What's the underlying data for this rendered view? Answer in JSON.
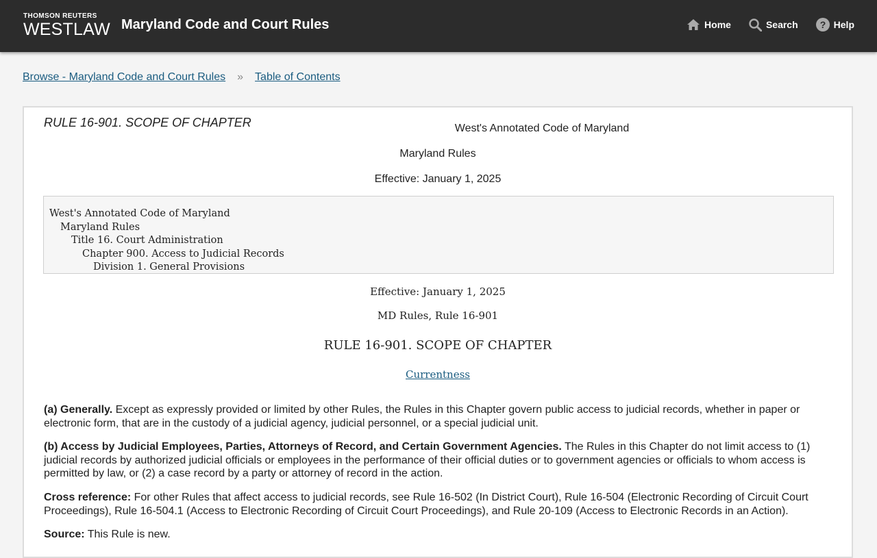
{
  "header": {
    "brand_small": "THOMSON REUTERS",
    "brand_big": "WESTLAW",
    "app_title": "Maryland Code and Court Rules",
    "nav": {
      "home": "Home",
      "search": "Search",
      "help": "Help"
    }
  },
  "breadcrumb": {
    "browse": "Browse - Maryland Code and Court Rules",
    "separator": "»",
    "toc": "Table of Contents"
  },
  "document": {
    "rule_heading": "RULE 16-901. SCOPE OF CHAPTER",
    "header_line1": "West's Annotated Code of Maryland",
    "header_line2": "Maryland Rules",
    "header_line3": "Effective: January 1, 2025",
    "toc": [
      "West's Annotated Code of Maryland",
      "Maryland Rules",
      "Title 16. Court Administration",
      "Chapter 900. Access to Judicial Records",
      "Division 1. General Provisions"
    ],
    "effective": "Effective: January 1, 2025",
    "citation": "MD Rules, Rule 16-901",
    "title": "RULE 16-901. SCOPE OF CHAPTER",
    "currentness": "Currentness",
    "paragraphs": {
      "a_label": "(a) Generally.",
      "a_text": " Except as expressly provided or limited by other Rules, the Rules in this Chapter govern public access to judicial records, whether in paper or electronic form, that are in the custody of a judicial agency, judicial personnel, or a special judicial unit.",
      "b_label": "(b) Access by Judicial Employees, Parties, Attorneys of Record, and Certain Government Agencies.",
      "b_text": " The Rules in this Chapter do not limit access to (1) judicial records by authorized judicial officials or employees in the performance of their official duties or to government agencies or officials to whom access is permitted by law, or (2) a case record by a party or attorney of record in the action.",
      "cross_label": "Cross reference:",
      "cross_text": " For other Rules that affect access to judicial records, see Rule 16-502 (In District Court), Rule 16-504 (Electronic Recording of Circuit Court Proceedings), Rule 16-504.1 (Access to Electronic Recording of Circuit Court Proceedings), and Rule 20-109 (Access to Electronic Records in an Action).",
      "source_label": "Source:",
      "source_text": " This Rule is new."
    }
  }
}
